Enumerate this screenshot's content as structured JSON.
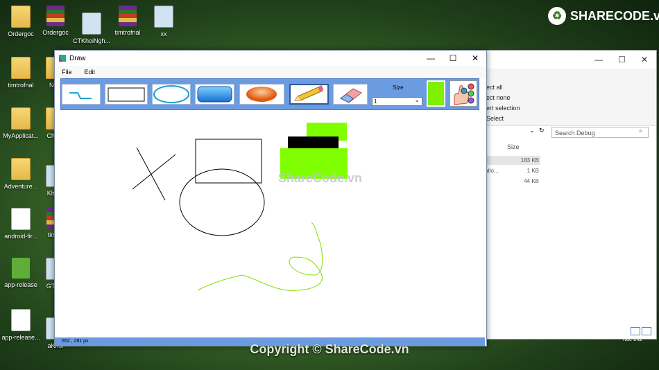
{
  "desktop": {
    "icons": [
      {
        "label": "Ordergoc",
        "kind": "folder"
      },
      {
        "label": "Ordergoc",
        "kind": "rar"
      },
      {
        "label": "CTKhoiNgh...",
        "kind": "thumb"
      },
      {
        "label": "timtrofnal",
        "kind": "rar"
      },
      {
        "label": "xx",
        "kind": "thumb"
      },
      {
        "label": "timtrofnal",
        "kind": "folder"
      },
      {
        "label": "New",
        "kind": "folder"
      },
      {
        "label": "MyApplicat...",
        "kind": "folder"
      },
      {
        "label": "ChatA",
        "kind": "folder"
      },
      {
        "label": "Adventure...",
        "kind": "folder"
      },
      {
        "label": "KhoiN",
        "kind": "thumb"
      },
      {
        "label": "android-fir...",
        "kind": "doc"
      },
      {
        "label": "timtro",
        "kind": "rar"
      },
      {
        "label": "app-release",
        "kind": "apk"
      },
      {
        "label": "GT_Gi",
        "kind": "thumb"
      },
      {
        "label": "app-release...",
        "kind": "doc"
      },
      {
        "label": "aKhoi",
        "kind": "thumb"
      }
    ]
  },
  "brand": {
    "logo_text": "SHARECODE.vn",
    "watermark": "ShareCode.vn",
    "copyright": "Copyright © ShareCode.vn"
  },
  "explorer": {
    "ribbon": [
      "ect all",
      "ect none",
      "ert selection",
      "Select"
    ],
    "search_placeholder": "Search Debug",
    "col_size": "Size",
    "rows": [
      {
        "name": "",
        "size": "183 KB"
      },
      {
        "name": "atio...",
        "size": "1 KB"
      },
      {
        "name": "",
        "size": "44 KB"
      }
    ],
    "side_text": "nac thai"
  },
  "window": {
    "title": "Draw",
    "menu": [
      "File",
      "Edit"
    ],
    "toolbar": {
      "tools": [
        "line-tool",
        "rectangle-tool",
        "ellipse-tool",
        "rounded-rect-tool",
        "filled-ellipse-tool",
        "pencil-tool",
        "eraser-tool"
      ],
      "selected": "pencil-tool",
      "size_label": "Size",
      "size_value": "1",
      "current_color": "#80f000"
    },
    "status": "652 , 281 px"
  }
}
